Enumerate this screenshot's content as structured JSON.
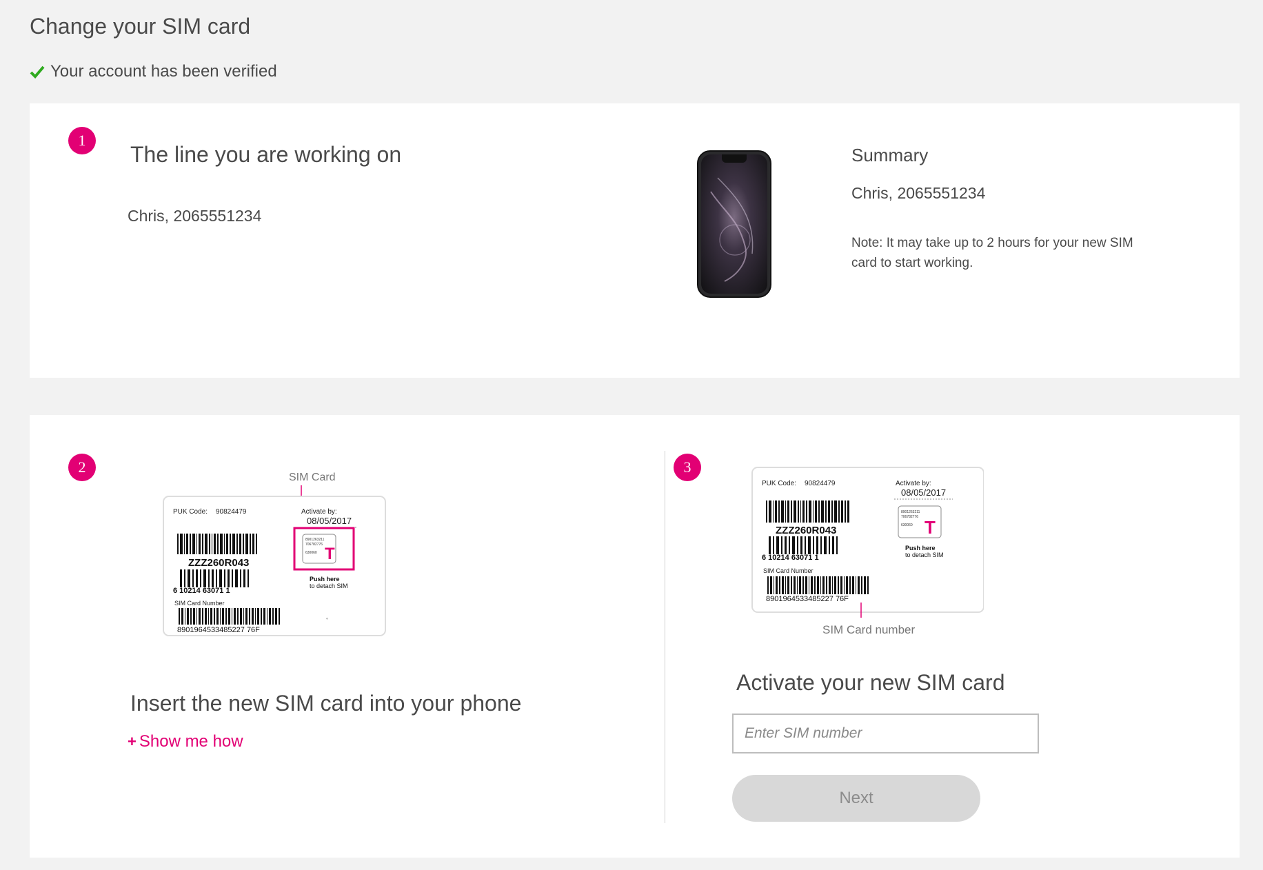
{
  "page": {
    "title": "Change your SIM card"
  },
  "verification": {
    "text": "Your account has been verified"
  },
  "line_section": {
    "step": "1",
    "heading": "The line you are working on",
    "line": "Chris, 2065551234"
  },
  "summary": {
    "heading": "Summary",
    "line": "Chris, 2065551234",
    "note": "Note: It may take up to 2 hours for your new SIM card to start working."
  },
  "insert_section": {
    "step": "2",
    "heading": "Insert the new SIM card into your phone",
    "show_me_how": "Show me how",
    "plus": "+"
  },
  "activate_section": {
    "step": "3",
    "heading": "Activate your new SIM card",
    "input_placeholder": "Enter SIM number",
    "next_label": "Next"
  },
  "sim_card_image": {
    "callout_sim": "SIM Card",
    "callout_number": "SIM Card number",
    "puk_label": "PUK Code:",
    "puk_value": "90824479",
    "activate_label": "Activate by:",
    "activate_date": "08/05/2017",
    "code": "ZZZ260R043",
    "barcode_number": "6 10214 63071 1",
    "sim_number_label": "SIM Card Number",
    "sim_number": "8901964533485227 76F",
    "push_text_1": "Push here",
    "push_text_2": "to detach SIM",
    "chip_line_1": "8901263211",
    "chip_line_2": "706782776",
    "chip_line_3": "630060"
  },
  "colors": {
    "brand": "#e20074",
    "check": "#2eaa1e",
    "background": "#f2f2f2"
  }
}
